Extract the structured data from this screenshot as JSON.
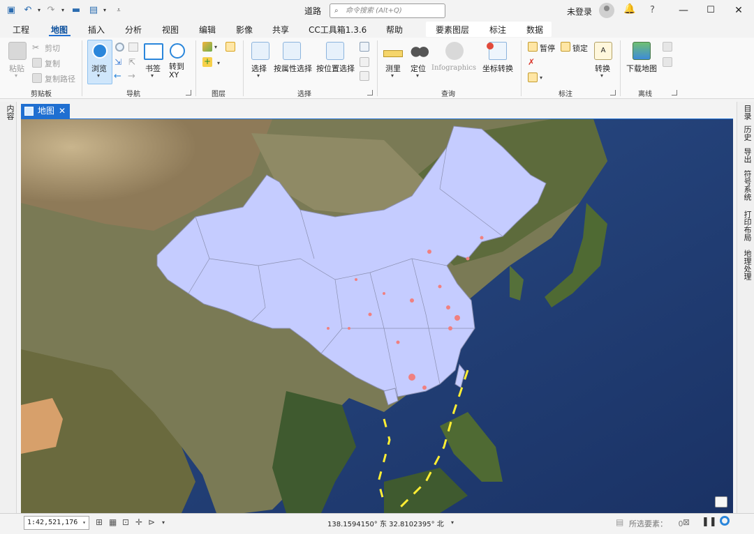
{
  "titlebar": {
    "app_title": "道路",
    "search_placeholder": "命令搜索 (Alt+Q)",
    "login": "未登录"
  },
  "tabs": [
    "工程",
    "地图",
    "插入",
    "分析",
    "视图",
    "编辑",
    "影像",
    "共享",
    "CC工具箱1.3.6",
    "帮助"
  ],
  "active_tab": "地图",
  "context_tabs": [
    "要素图层",
    "标注",
    "数据"
  ],
  "ribbon": {
    "clipboard": {
      "paste": "粘贴",
      "cut": "剪切",
      "copy": "复制",
      "copy_path": "复制路径",
      "label": "剪贴板"
    },
    "navigate": {
      "explore": "浏览",
      "bookmarks": "书签",
      "goto_xy": "转到\nXY",
      "label": "导航"
    },
    "layer": {
      "label": "图层"
    },
    "selection": {
      "select": "选择",
      "by_attr": "按属性选择",
      "by_loc": "按位置选择",
      "label": "选择"
    },
    "inquiry": {
      "measure": "测里",
      "locate": "定位",
      "infographics": "Infographics",
      "coord_convert": "坐标转换",
      "label": "查询"
    },
    "labeling": {
      "pause": "暂停",
      "lock": "锁定",
      "convert": "转换",
      "label": "标注"
    },
    "offline": {
      "download_map": "下载地图",
      "label": "离线"
    }
  },
  "side_left": [
    "内容"
  ],
  "side_right": [
    "目录",
    "历史",
    "导出",
    "符号系统",
    "打印布局",
    "地理处理"
  ],
  "map_tab": {
    "label": "地图"
  },
  "statusbar": {
    "scale": "1:42,521,176",
    "coordinates": "138.1594150° 东 32.8102395° 北",
    "selected_features": "所选要素：",
    "selected_count": "0"
  },
  "colors": {
    "accent": "#1f6fd1",
    "polygon_fill": "#c5ccff",
    "polygon_stroke": "#8a8fb0",
    "highlight": "#f08080",
    "dash_line": "#ffee33"
  }
}
